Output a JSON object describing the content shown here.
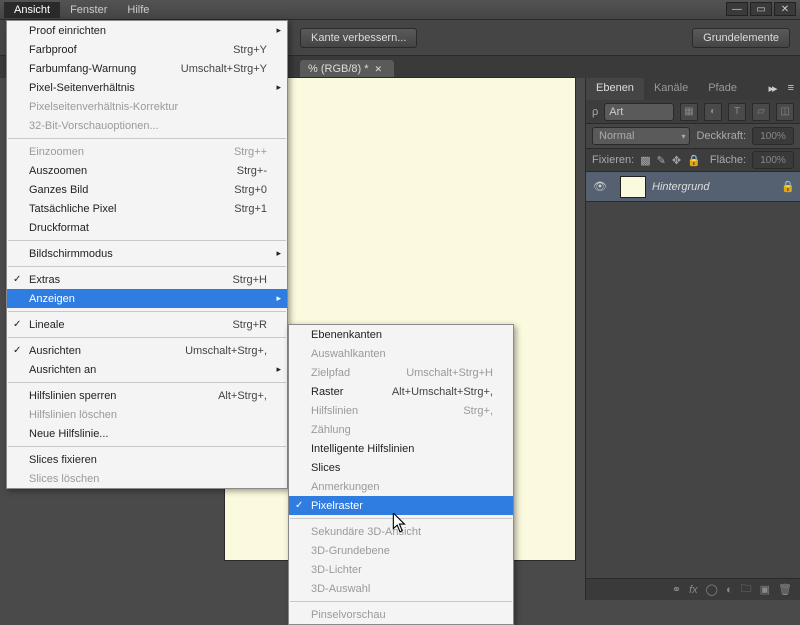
{
  "menubar": {
    "items": [
      "Ansicht",
      "Fenster",
      "Hilfe"
    ],
    "activeIndex": 0
  },
  "toolbar": {
    "btn1": "Kante verbessern...",
    "btn2": "Grundelemente"
  },
  "tab": {
    "label": "% (RGB/8) *"
  },
  "panel": {
    "tabs": [
      "Ebenen",
      "Kanäle",
      "Pfade"
    ],
    "search_label": "Art",
    "blend": "Normal",
    "opacity_label": "Deckkraft:",
    "opacity_val": "100%",
    "lock_label": "Fixieren:",
    "fill_label": "Fläche:",
    "fill_val": "100%",
    "layer_name": "Hintergrund"
  },
  "menu1": [
    {
      "t": "item",
      "label": "Proof einrichten",
      "sub": true
    },
    {
      "t": "item",
      "label": "Farbproof",
      "shortcut": "Strg+Y"
    },
    {
      "t": "item",
      "label": "Farbumfang-Warnung",
      "shortcut": "Umschalt+Strg+Y"
    },
    {
      "t": "item",
      "label": "Pixel-Seitenverhältnis",
      "sub": true
    },
    {
      "t": "item",
      "label": "Pixelseitenverhältnis-Korrektur",
      "disabled": true
    },
    {
      "t": "item",
      "label": "32-Bit-Vorschauoptionen...",
      "disabled": true
    },
    {
      "t": "sep"
    },
    {
      "t": "item",
      "label": "Einzoomen",
      "shortcut": "Strg++",
      "disabled": true
    },
    {
      "t": "item",
      "label": "Auszoomen",
      "shortcut": "Strg+-"
    },
    {
      "t": "item",
      "label": "Ganzes Bild",
      "shortcut": "Strg+0"
    },
    {
      "t": "item",
      "label": "Tatsächliche Pixel",
      "shortcut": "Strg+1"
    },
    {
      "t": "item",
      "label": "Druckformat"
    },
    {
      "t": "sep"
    },
    {
      "t": "item",
      "label": "Bildschirmmodus",
      "sub": true
    },
    {
      "t": "sep"
    },
    {
      "t": "item",
      "label": "Extras",
      "shortcut": "Strg+H",
      "check": true
    },
    {
      "t": "item",
      "label": "Anzeigen",
      "sub": true,
      "highlight": true
    },
    {
      "t": "sep"
    },
    {
      "t": "item",
      "label": "Lineale",
      "shortcut": "Strg+R",
      "check": true
    },
    {
      "t": "sep"
    },
    {
      "t": "item",
      "label": "Ausrichten",
      "shortcut": "Umschalt+Strg+,",
      "check": true
    },
    {
      "t": "item",
      "label": "Ausrichten an",
      "sub": true
    },
    {
      "t": "sep"
    },
    {
      "t": "item",
      "label": "Hilfslinien sperren",
      "shortcut": "Alt+Strg+,"
    },
    {
      "t": "item",
      "label": "Hilfslinien löschen",
      "disabled": true
    },
    {
      "t": "item",
      "label": "Neue Hilfslinie..."
    },
    {
      "t": "sep"
    },
    {
      "t": "item",
      "label": "Slices fixieren"
    },
    {
      "t": "item",
      "label": "Slices löschen",
      "disabled": true
    }
  ],
  "menu2": [
    {
      "t": "item",
      "label": "Ebenenkanten"
    },
    {
      "t": "item",
      "label": "Auswahlkanten",
      "disabled": true
    },
    {
      "t": "item",
      "label": "Zielpfad",
      "shortcut": "Umschalt+Strg+H",
      "disabled": true
    },
    {
      "t": "item",
      "label": "Raster",
      "shortcut": "Alt+Umschalt+Strg+,"
    },
    {
      "t": "item",
      "label": "Hilfslinien",
      "shortcut": "Strg+,",
      "disabled": true
    },
    {
      "t": "item",
      "label": "Zählung",
      "disabled": true
    },
    {
      "t": "item",
      "label": "Intelligente Hilfslinien"
    },
    {
      "t": "item",
      "label": "Slices"
    },
    {
      "t": "item",
      "label": "Anmerkungen",
      "disabled": true
    },
    {
      "t": "item",
      "label": "Pixelraster",
      "check": true,
      "highlight": true
    },
    {
      "t": "sep"
    },
    {
      "t": "item",
      "label": "Sekundäre 3D-Ansicht",
      "disabled": true
    },
    {
      "t": "item",
      "label": "3D-Grundebene",
      "disabled": true
    },
    {
      "t": "item",
      "label": "3D-Lichter",
      "disabled": true
    },
    {
      "t": "item",
      "label": "3D-Auswahl",
      "disabled": true
    },
    {
      "t": "sep"
    },
    {
      "t": "item",
      "label": "Pinselvorschau",
      "disabled": true
    }
  ]
}
